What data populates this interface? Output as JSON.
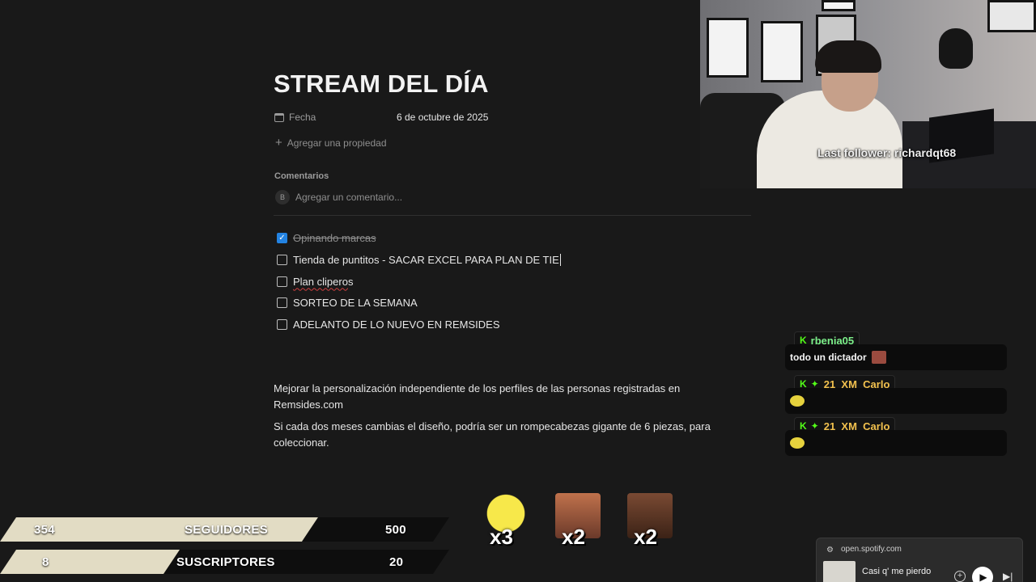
{
  "page": {
    "title": "STREAM DEL DÍA",
    "date_label": "Fecha",
    "date_value": "6 de octubre de 2025",
    "add_property": "Agregar una propiedad",
    "comments_heading": "Comentarios",
    "avatar_initial": "B",
    "comment_placeholder": "Agregar un comentario...",
    "todos": [
      {
        "label": "Opinando marcas",
        "checked": true
      },
      {
        "label": "Tienda de puntitos - SACAR EXCEL PARA PLAN DE TIE",
        "checked": false
      },
      {
        "label": "Plan clipero",
        "label_b": "s",
        "checked": false
      },
      {
        "label": "SORTEO DE LA SEMANA",
        "checked": false
      },
      {
        "label": "ADELANTO DE LO NUEVO EN REMSIDES",
        "checked": false
      }
    ],
    "paragraphs": [
      "Mejorar la personalización independiente de los perfiles de las personas registradas en Remsides.com",
      "Si cada dos meses cambias el diseño, podría ser un rompecabezas gigante de 6 piezas, para coleccionar."
    ]
  },
  "overlay": {
    "last_follower": "Last follower: richardqt68",
    "chat": [
      {
        "user": "rbenja05",
        "message": "todo un dictador"
      },
      {
        "user": "21_XM_Carlo",
        "message": ""
      },
      {
        "user": "21_XM_Carlo",
        "message": ""
      }
    ],
    "goals": [
      {
        "current": "354",
        "label": "SEGUIDORES",
        "target": "500",
        "progress": 0.708
      },
      {
        "current": "8",
        "label": "SUSCRIPTORES",
        "target": "20",
        "progress": 0.4
      }
    ],
    "emote_counts": [
      "x3",
      "x2",
      "x2"
    ]
  },
  "spotify": {
    "url": "open.spotify.com",
    "song": "Casi q' me pierdo"
  },
  "colors": {
    "background": "#191919",
    "checkbox_accent": "#2383e2",
    "kick_green": "#53fc18",
    "goal_fill": "#e2dcc4"
  }
}
